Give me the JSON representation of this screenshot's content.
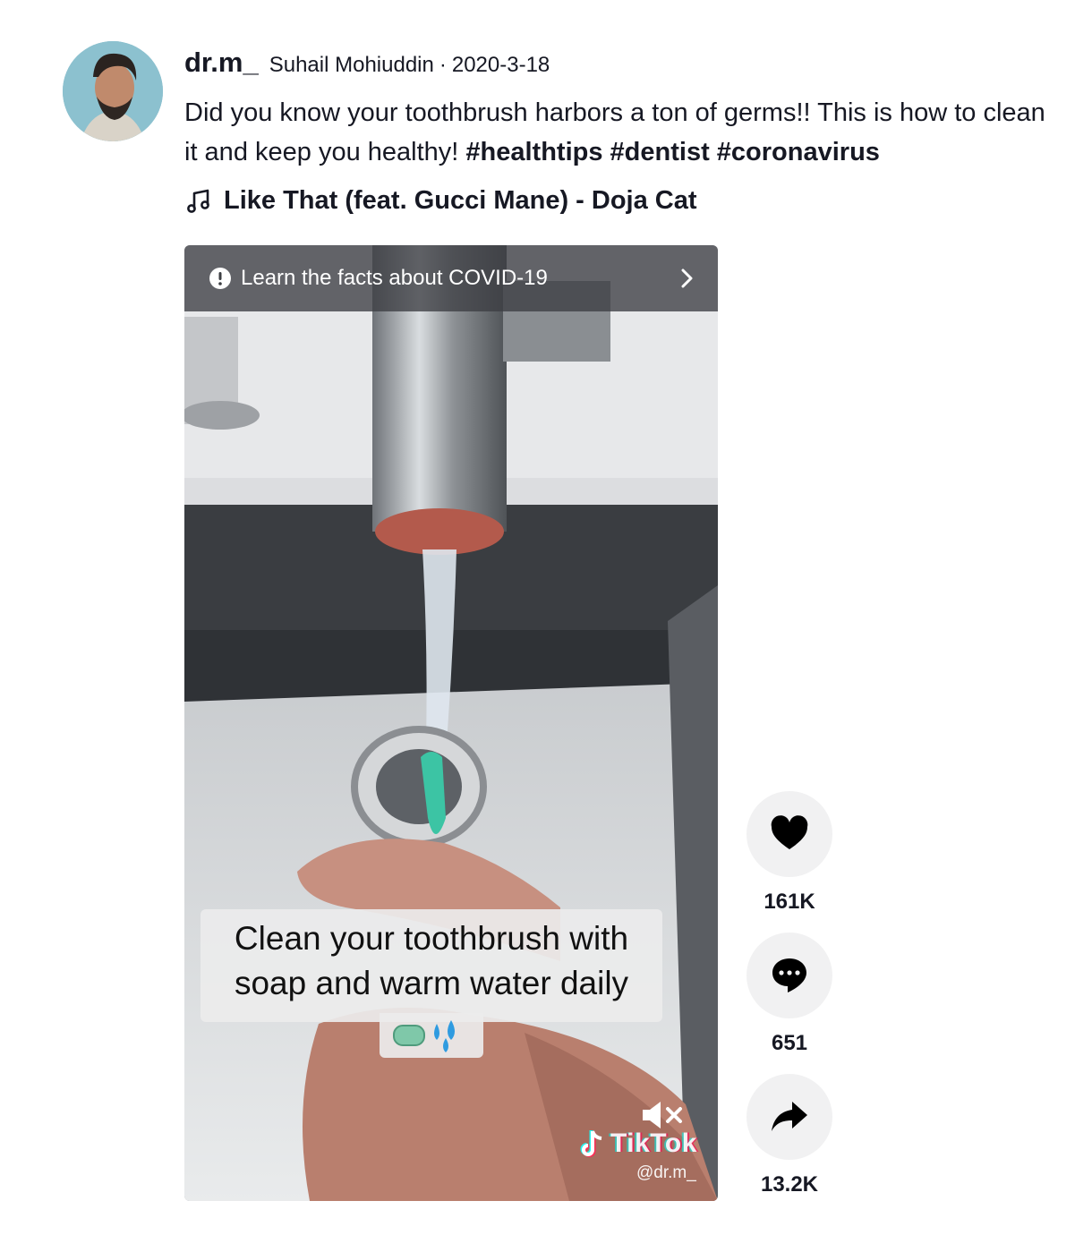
{
  "post": {
    "username": "dr.m_",
    "nickname": "Suhail Mohiuddin",
    "separator": "·",
    "date": "2020-3-18",
    "caption_text": "Did you know your toothbrush harbors a ton of germs!! This is how to clean it and keep you healthy! ",
    "hashtags": [
      "#healthtips",
      "#dentist",
      "#coronavirus"
    ],
    "music": "Like That (feat. Gucci Mane) - Doja Cat"
  },
  "video": {
    "covid_banner": "Learn the facts about COVID-19",
    "overlay_line1": "Clean your toothbrush with",
    "overlay_line2": "soap and warm water daily",
    "watermark": "TikTok",
    "handle": "@dr.m_"
  },
  "actions": {
    "likes": "161K",
    "comments": "651",
    "shares": "13.2K"
  },
  "colors": {
    "text": "#161823",
    "action_bg": "#f1f1f2",
    "toothbrush": "#3cc4a4"
  },
  "icons": [
    "music-note-icon",
    "alert-icon",
    "chevron-right-icon",
    "mute-icon",
    "tiktok-logo-icon",
    "heart-icon",
    "comment-icon",
    "share-icon"
  ]
}
